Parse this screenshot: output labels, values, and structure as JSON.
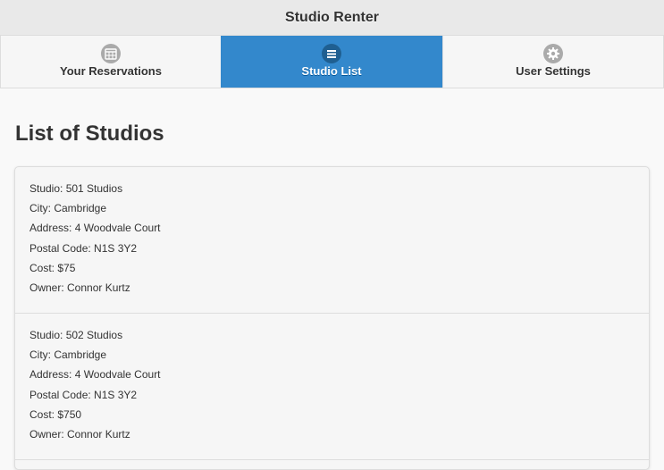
{
  "header": {
    "title": "Studio Renter"
  },
  "nav": {
    "tabs": [
      {
        "label": "Your Reservations",
        "icon": "calendar-icon",
        "active": false
      },
      {
        "label": "Studio List",
        "icon": "list-icon",
        "active": true
      },
      {
        "label": "User Settings",
        "icon": "gear-icon",
        "active": false
      }
    ]
  },
  "main": {
    "heading": "List of Studios",
    "studios": [
      {
        "studio": "Studio: 501 Studios",
        "city": "City: Cambridge",
        "address": "Address: 4 Woodvale Court",
        "postal": "Postal Code: N1S 3Y2",
        "cost": "Cost: $75",
        "owner": "Owner: Connor Kurtz"
      },
      {
        "studio": "Studio: 502 Studios",
        "city": "City: Cambridge",
        "address": "Address: 4 Woodvale Court",
        "postal": "Postal Code: N1S 3Y2",
        "cost": "Cost: $750",
        "owner": "Owner: Connor Kurtz"
      }
    ]
  },
  "colors": {
    "accent": "#3388cc",
    "header_bg": "#e9e9e9",
    "page_bg": "#f9f9f9"
  }
}
